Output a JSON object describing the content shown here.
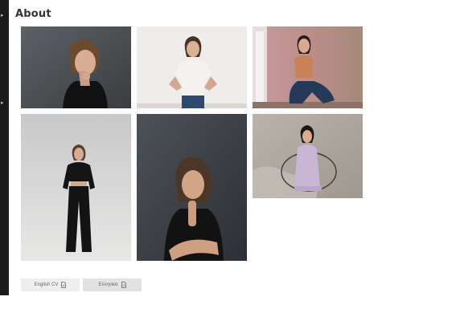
{
  "page": {
    "title": "About"
  },
  "sidebar": {
    "icons": [
      "menu-glyph",
      "menu-glyph"
    ]
  },
  "gallery": {
    "photos": [
      {
        "name": "photo-portrait-hand-on-chin"
      },
      {
        "name": "photo-white-wall-standing"
      },
      {
        "name": "photo-seated-pink-wall"
      },
      {
        "name": "photo-full-length-black-outfit"
      },
      {
        "name": "photo-portrait-dark-background"
      },
      {
        "name": "photo-wire-chair-seated"
      }
    ]
  },
  "buttons": {
    "english_cv": "English CV",
    "greek_cv": "Ελληνικα"
  },
  "icons": {
    "document": "document-icon"
  }
}
